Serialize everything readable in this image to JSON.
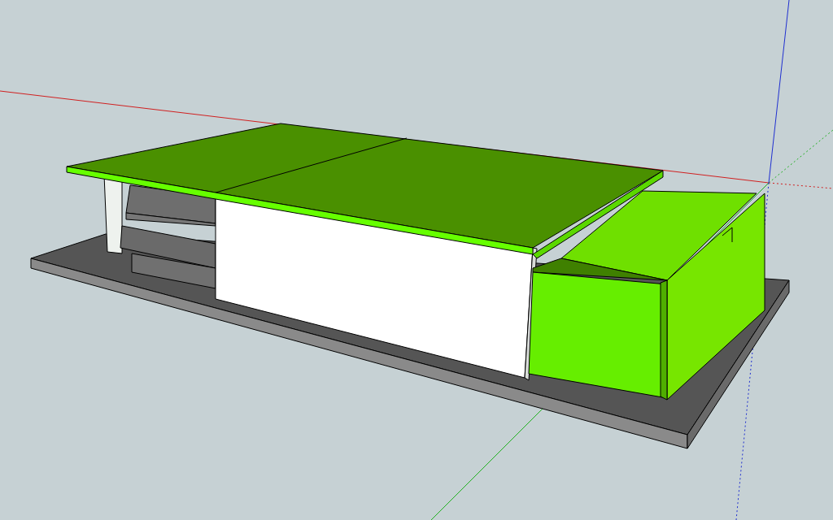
{
  "viewport": {
    "show_axes": true
  }
}
